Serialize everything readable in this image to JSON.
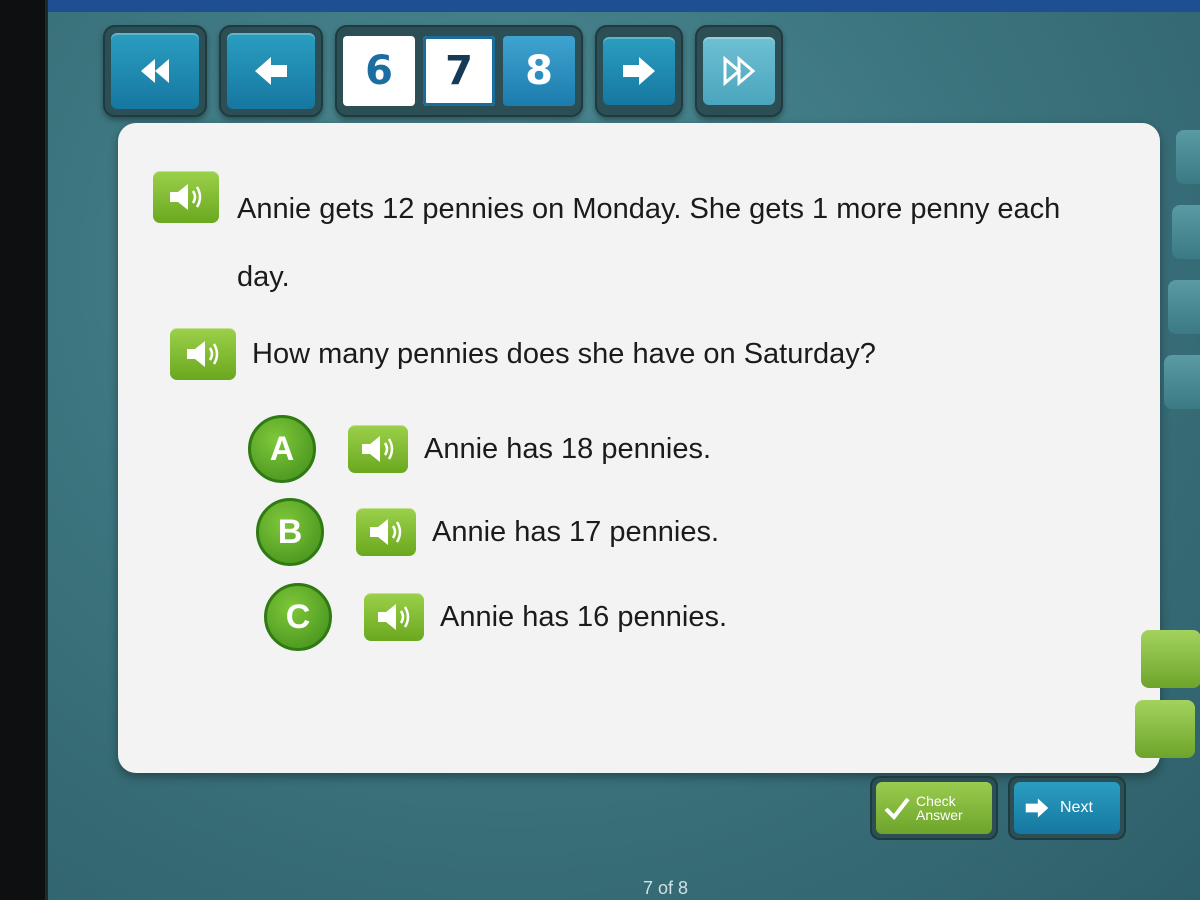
{
  "nav": {
    "pages": [
      {
        "label": "6",
        "state": "visited"
      },
      {
        "label": "7",
        "state": "current"
      },
      {
        "label": "8",
        "state": "next"
      }
    ],
    "icons": [
      "rewind-to-first-icon",
      "back-arrow-icon",
      "forward-arrow-icon",
      "fast-forward-to-last-icon"
    ]
  },
  "question": {
    "prompt": "Annie gets 12 pennies on Monday. She gets 1 more penny each day.",
    "text": "How many pennies does she have on Saturday?",
    "choices": [
      {
        "letter": "A",
        "text": "Annie has 18 pennies."
      },
      {
        "letter": "B",
        "text": "Annie has 17 pennies."
      },
      {
        "letter": "C",
        "text": "Annie has 16 pennies."
      }
    ]
  },
  "footer": {
    "check_label_line1": "Check",
    "check_label_line2": "Answer",
    "next_label": "Next",
    "page_indicator": "7 of 8"
  },
  "colors": {
    "accent_green": "#6aa81f",
    "accent_blue": "#1677a0",
    "background_teal": "#3d7680",
    "panel": "#f3f3f3"
  }
}
